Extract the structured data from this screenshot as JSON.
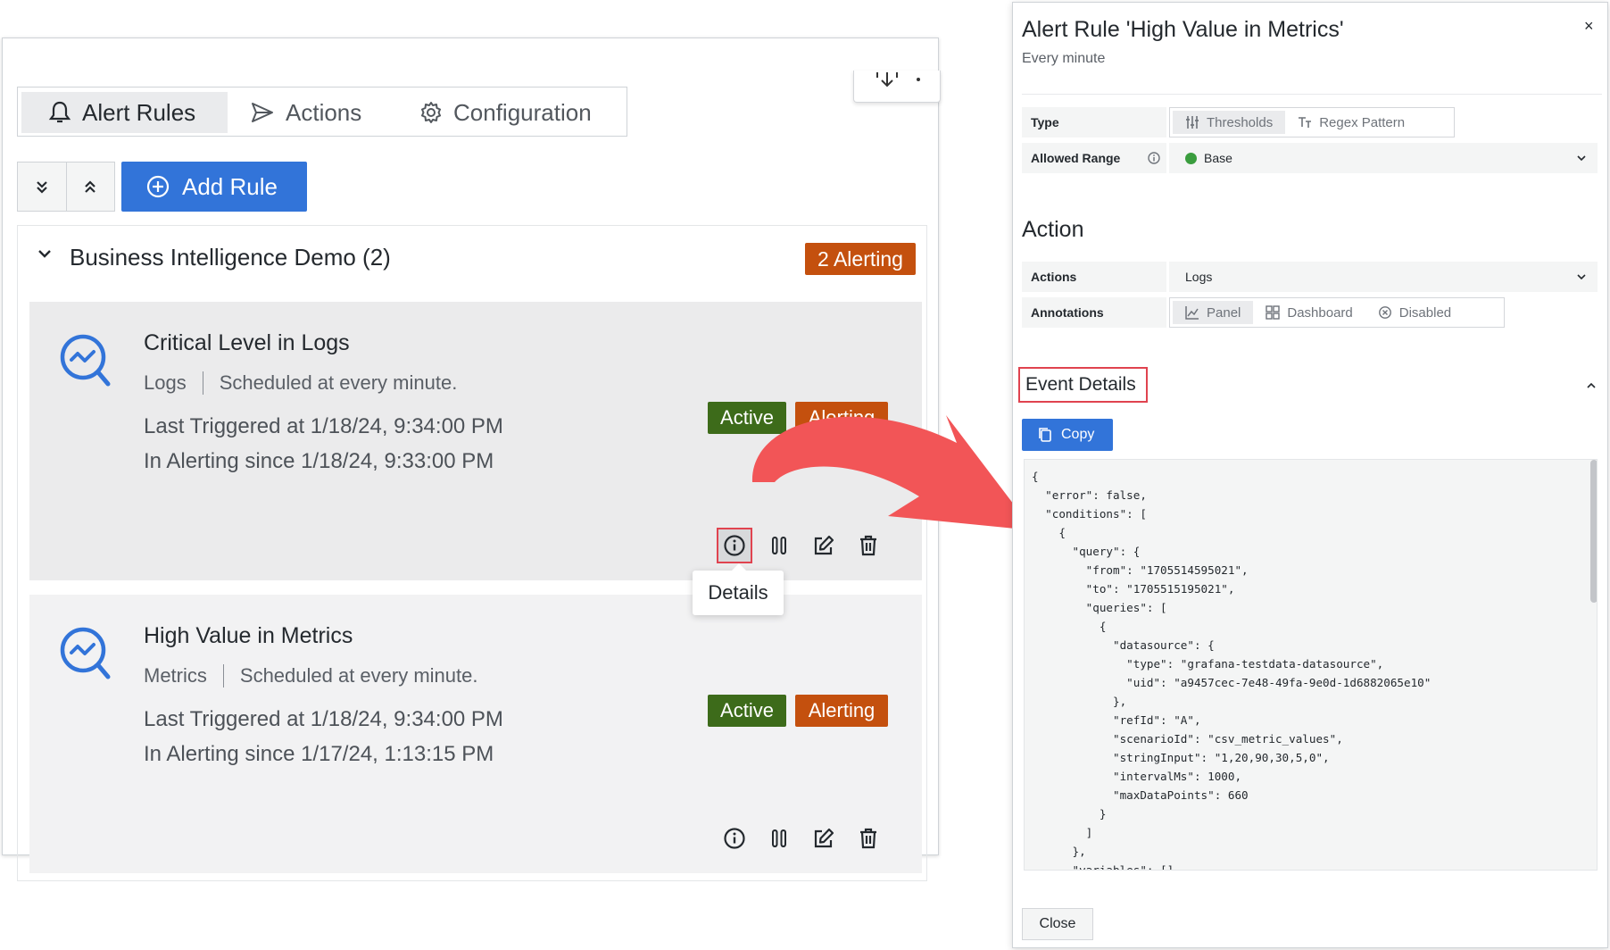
{
  "left": {
    "tabs": [
      {
        "label": "Alert Rules",
        "icon": "bell-icon",
        "active": true
      },
      {
        "label": "Actions",
        "icon": "send-icon",
        "active": false
      },
      {
        "label": "Configuration",
        "icon": "gear-icon",
        "active": false
      }
    ],
    "add_rule_label": "Add Rule",
    "group": {
      "title": "Business Intelligence Demo (2)",
      "badge": "2 Alerting"
    },
    "rules": [
      {
        "title": "Critical Level in Logs",
        "source": "Logs",
        "schedule": "Scheduled at every minute.",
        "last_triggered": "Last Triggered at 1/18/24, 9:34:00 PM",
        "alerting_since": "In Alerting since 1/18/24, 9:33:00 PM",
        "status_active": "Active",
        "status_alerting": "Alerting"
      },
      {
        "title": "High Value in Metrics",
        "source": "Metrics",
        "schedule": "Scheduled at every minute.",
        "last_triggered": "Last Triggered at 1/18/24, 9:34:00 PM",
        "alerting_since": "In Alerting since 1/17/24, 1:13:15 PM",
        "status_active": "Active",
        "status_alerting": "Alerting"
      }
    ],
    "tooltip": "Details"
  },
  "drawer": {
    "title": "Alert Rule 'High Value in Metrics'",
    "subtitle": "Every minute",
    "close_x": "×",
    "type_label": "Type",
    "type_options": [
      "Thresholds",
      "Regex Pattern"
    ],
    "allowed_range_label": "Allowed Range",
    "allowed_range_value": "Base",
    "action_heading": "Action",
    "actions_label": "Actions",
    "actions_value": "Logs",
    "annotations_label": "Annotations",
    "annotation_options": [
      "Panel",
      "Dashboard",
      "Disabled"
    ],
    "event_details_heading": "Event Details",
    "copy_label": "Copy",
    "code": "{\n  \"error\": false,\n  \"conditions\": [\n    {\n      \"query\": {\n        \"from\": \"1705514595021\",\n        \"to\": \"1705515195021\",\n        \"queries\": [\n          {\n            \"datasource\": {\n              \"type\": \"grafana-testdata-datasource\",\n              \"uid\": \"a9457cec-7e48-49fa-9e0d-1d6882065e10\"\n            },\n            \"refId\": \"A\",\n            \"scenarioId\": \"csv_metric_values\",\n            \"stringInput\": \"1,20,90,30,5,0\",\n            \"intervalMs\": 1000,\n            \"maxDataPoints\": 660\n          }\n        ]\n      },\n      \"variables\": []",
    "close_label": "Close"
  },
  "colors": {
    "primary": "#3274d9",
    "alerting": "#c4500e",
    "active": "#3d6b1a",
    "highlight": "#e0434f",
    "arrow": "#f25557"
  }
}
